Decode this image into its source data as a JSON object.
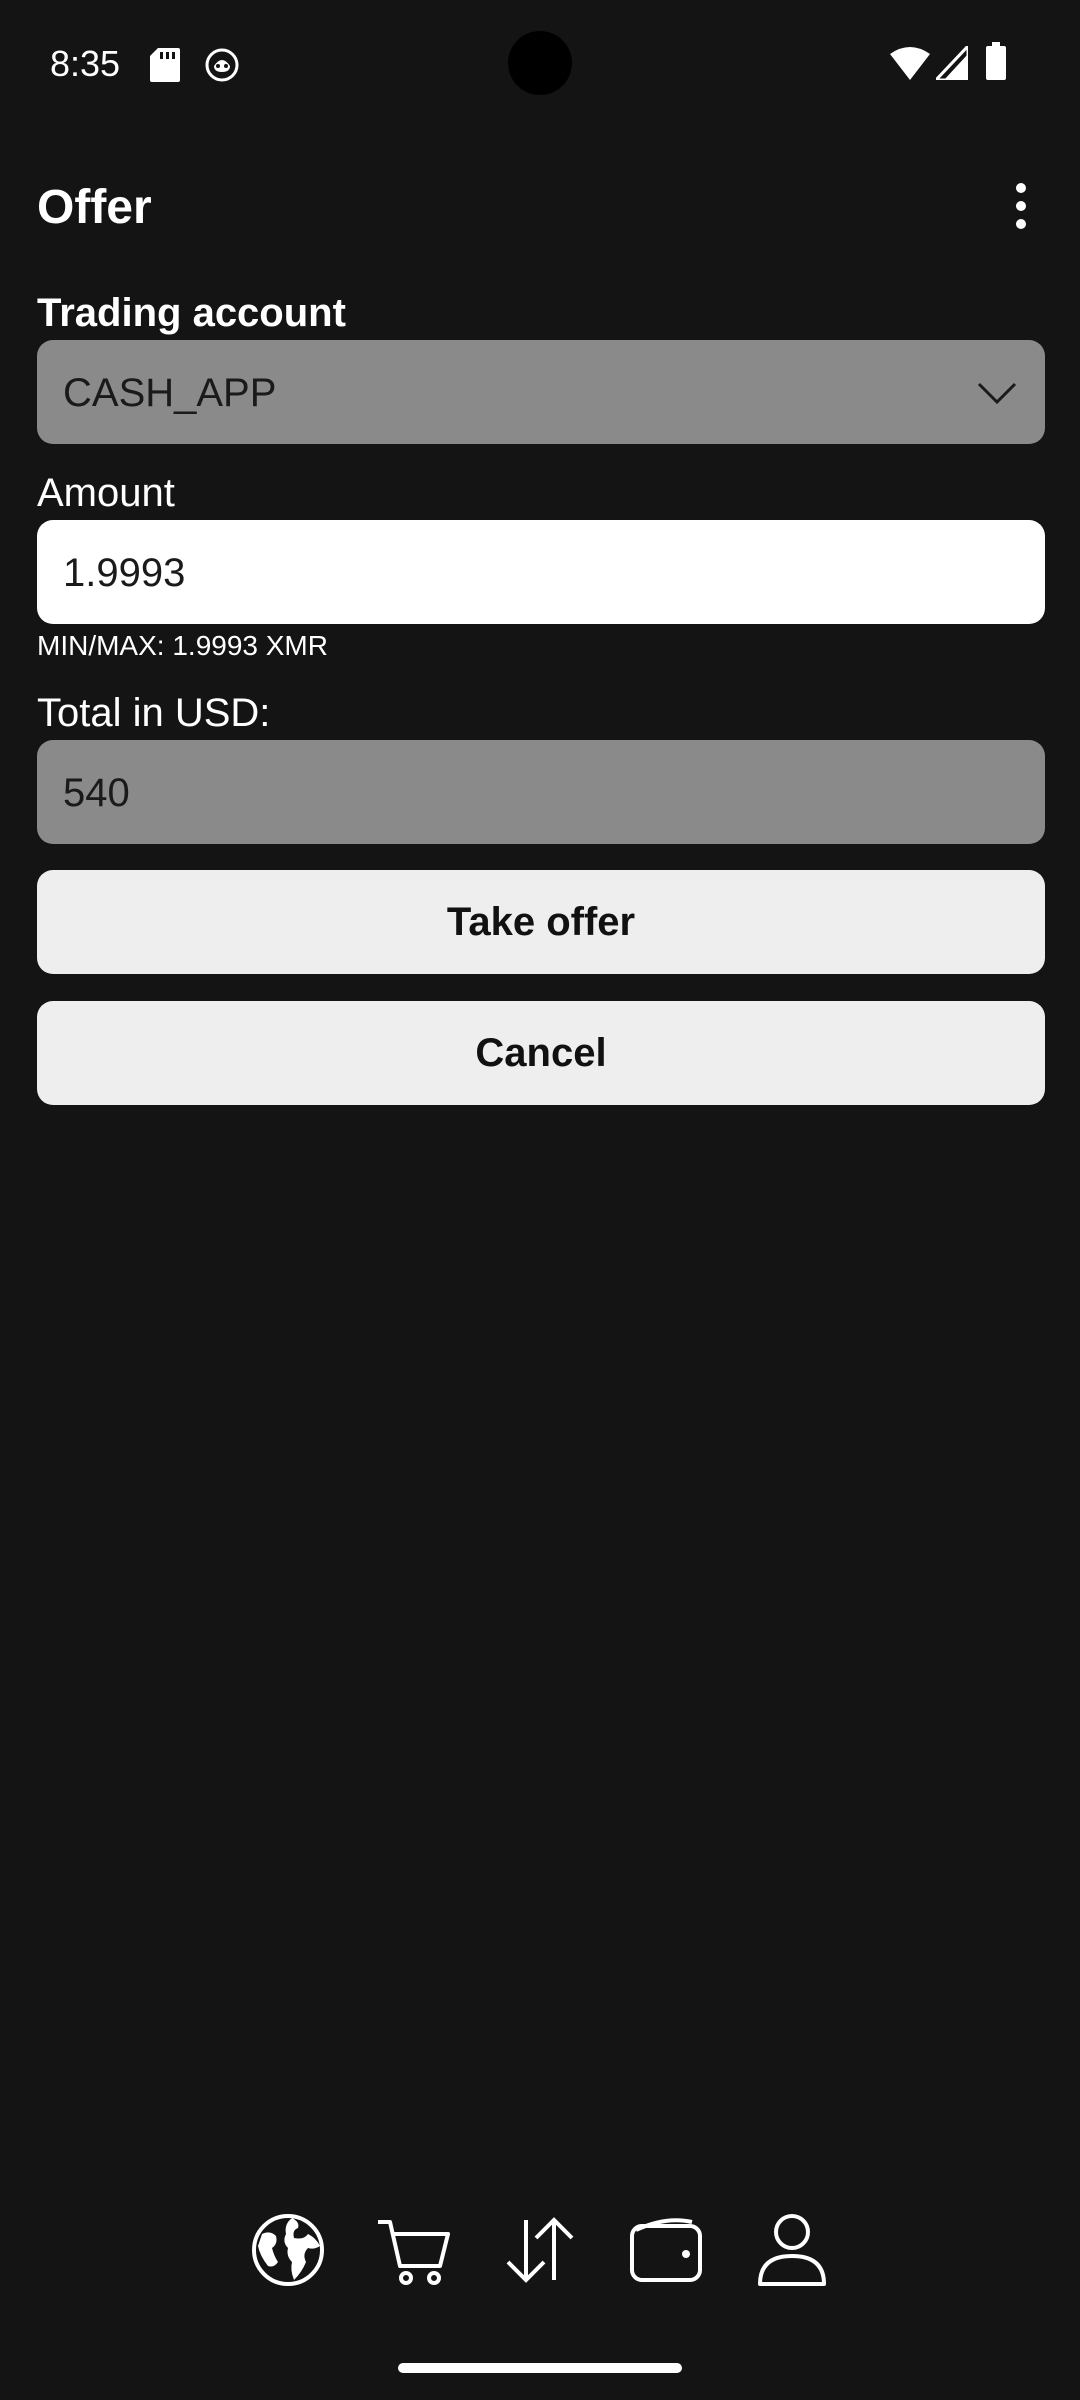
{
  "status_bar": {
    "time": "8:35",
    "left_icons": [
      "sd-card-icon",
      "app-notification-icon"
    ],
    "right_icons": [
      "wifi-icon",
      "signal-icon",
      "battery-icon"
    ]
  },
  "header": {
    "title": "Offer",
    "menu_icon": "more-vertical-icon"
  },
  "form": {
    "trading_account_label": "Trading account",
    "trading_account_value": "CASH_APP",
    "amount_label": "Amount",
    "amount_value": "1.9993",
    "min_max_hint": "MIN/MAX: 1.9993 XMR",
    "total_label": "Total in USD:",
    "total_value": "540"
  },
  "actions": {
    "take_offer_label": "Take offer",
    "cancel_label": "Cancel"
  },
  "bottom_nav": {
    "items": [
      {
        "icon": "globe-icon"
      },
      {
        "icon": "cart-icon"
      },
      {
        "icon": "swap-arrows-icon"
      },
      {
        "icon": "wallet-icon"
      },
      {
        "icon": "person-icon"
      }
    ]
  },
  "colors": {
    "background": "#141414",
    "field_disabled": "#8a8a8a",
    "field_enabled": "#ffffff",
    "button": "#eeeeee"
  }
}
